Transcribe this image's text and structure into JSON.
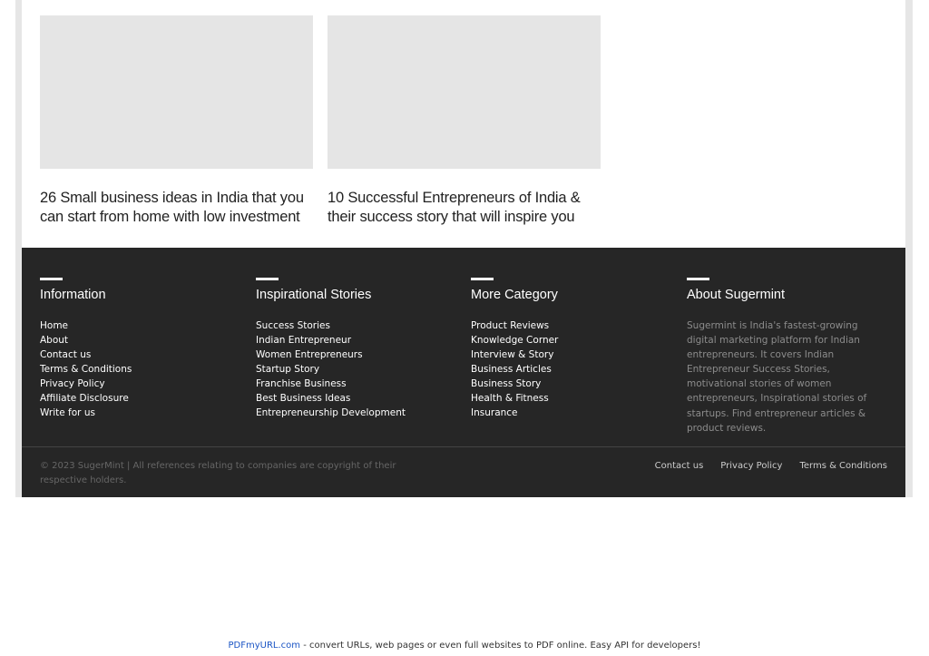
{
  "cards": [
    {
      "title": "26 Small business ideas in India that you can start from home with low investment"
    },
    {
      "title": "10 Successful Entrepreneurs of India & their success story that will inspire you"
    }
  ],
  "footer": {
    "information": {
      "heading": "Information",
      "links": [
        "Home",
        "About",
        "Contact us",
        "Terms & Conditions",
        "Privacy Policy",
        "Affiliate Disclosure",
        "Write for us"
      ]
    },
    "inspirational": {
      "heading": "Inspirational Stories",
      "links": [
        "Success Stories",
        "Indian Entrepreneur",
        "Women Entrepreneurs",
        "Startup Story",
        "Franchise Business",
        "Best Business Ideas",
        "Entrepreneurship Development"
      ]
    },
    "more_category": {
      "heading": "More Category",
      "links": [
        "Product Reviews",
        "Knowledge Corner",
        "Interview & Story",
        "Business Articles",
        "Business Story",
        "Health & Fitness",
        "Insurance"
      ]
    },
    "about": {
      "heading": "About Sugermint",
      "text": "Sugermint is India's fastest-growing digital marketing platform for Indian entrepreneurs. It covers Indian Entrepreneur Success Stories, motivational stories of women entrepreneurs, Inspirational stories of startups. Find entrepreneur articles & product reviews."
    },
    "copyright": "© 2023 SugerMint | All references relating to companies are copyright of their respective holders.",
    "bottom_links": [
      "Contact us",
      "Privacy Policy",
      "Terms & Conditions"
    ]
  },
  "banner": {
    "link": "PDFmyURL.com",
    "text": " - convert URLs, web pages or even full websites to PDF online. Easy API for developers!"
  }
}
